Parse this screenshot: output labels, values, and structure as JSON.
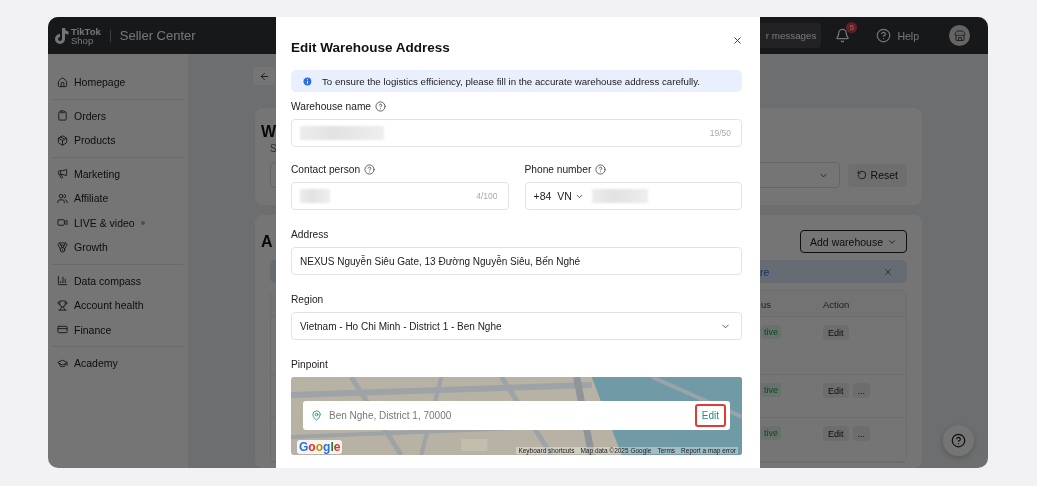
{
  "header": {
    "logo_top": "TikTok",
    "logo_bottom": "Shop",
    "title": "Seller Center",
    "messages": "r messages",
    "notification_count": "5",
    "help": "Help"
  },
  "sidebar": {
    "groups": [
      [
        {
          "label": "Homepage",
          "dot": false
        }
      ],
      [
        {
          "label": "Orders",
          "dot": false
        },
        {
          "label": "Products",
          "dot": false
        }
      ],
      [
        {
          "label": "Marketing",
          "dot": false
        },
        {
          "label": "Affiliate",
          "dot": false
        },
        {
          "label": "LIVE & video",
          "dot": true
        },
        {
          "label": "Growth",
          "dot": false
        }
      ],
      [
        {
          "label": "Data compass",
          "dot": false
        },
        {
          "label": "Account health",
          "dot": false
        },
        {
          "label": "Finance",
          "dot": false
        }
      ],
      [
        {
          "label": "Academy",
          "dot": false
        }
      ]
    ]
  },
  "background": {
    "card_title": "W",
    "card_subtitle": "S",
    "reset": "Reset",
    "section_title": "A",
    "add_warehouse": "Add warehouse",
    "banner_text": "re",
    "table": {
      "columns": [
        "us",
        "Action"
      ],
      "rows": [
        {
          "status": "tive",
          "actions": [
            "Edit"
          ]
        },
        {
          "status": "tive",
          "actions": [
            "Edit",
            "..."
          ]
        },
        {
          "status": "tive",
          "actions": [
            "Edit",
            "..."
          ]
        }
      ]
    }
  },
  "modal": {
    "title": "Edit Warehouse Address",
    "notice": "To ensure the logistics efficiency, please fill in the accurate warehouse address carefully.",
    "warehouse_name": {
      "label": "Warehouse name",
      "help": true,
      "counter": "19/50"
    },
    "contact_person": {
      "label": "Contact person",
      "help": true,
      "counter": "4/100"
    },
    "phone_number": {
      "label": "Phone number",
      "help": true,
      "code": "+84",
      "country": "VN"
    },
    "address": {
      "label": "Address",
      "value": "NEXUS Nguyễn Siêu Gate, 13 Đường Nguyễn Siêu, Bến Nghé"
    },
    "region": {
      "label": "Region",
      "value": "Vietnam - Ho Chi Minh - District 1 - Ben Nghe"
    },
    "pinpoint": {
      "label": "Pinpoint",
      "location": "Ben Nghe, District 1, 70000",
      "edit": "Edit",
      "highlighted": true,
      "logo": "Google",
      "links": [
        "Keyboard shortcuts",
        "Map data ©2025 Google",
        "Terms",
        "Report a map error"
      ]
    }
  }
}
